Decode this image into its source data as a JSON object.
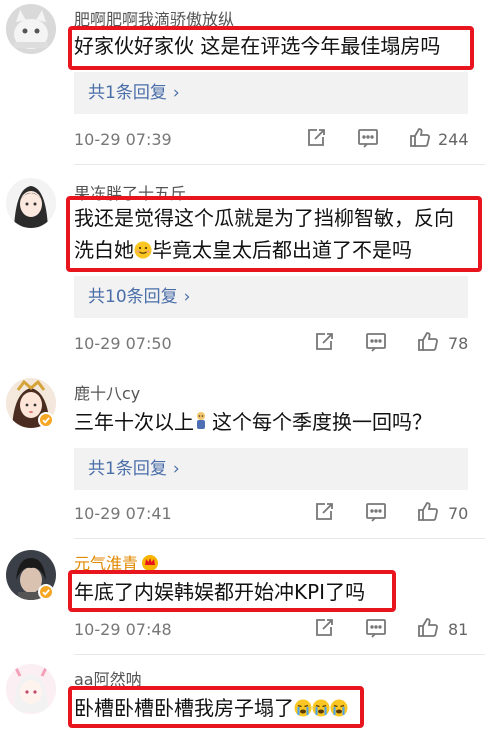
{
  "comments": [
    {
      "username": "肥啊肥啊我滴骄傲放纵",
      "text": "好家伙好家伙 这是在评选今年最佳塌房吗",
      "replies": "共1条回复",
      "date": "10-29 07:39",
      "likes": "244"
    },
    {
      "username": "果冻胖了十五斤",
      "text_line1": "我还是觉得这个瓜就是为了挡柳智敏，反向",
      "text_line2a": "洗白她",
      "text_line2b": "毕竟太皇太后都出道了不是吗",
      "replies": "共10条回复",
      "date": "10-29 07:50",
      "likes": "78"
    },
    {
      "username": "鹿十八cy",
      "text_a": "三年十次以上",
      "text_b": "这个每个季度换一回吗？",
      "replies": "共1条回复",
      "date": "10-29 07:41",
      "likes": "70"
    },
    {
      "username": "元气淮青",
      "text": "年底了内娱韩娱都开始冲KPI了吗",
      "date": "10-29 07:48",
      "likes": "81"
    },
    {
      "username": "aa阿然呐",
      "text": "卧槽卧槽卧槽我房子塌了"
    }
  ],
  "icons": {
    "share": "share-icon",
    "comment": "comment-icon",
    "like": "thumbs-up-icon",
    "chevron": "chevron-right-icon"
  },
  "colors": {
    "highlight_box": "#e8141e",
    "link_blue": "#4a6ea8",
    "vip_gold": "#e08a00"
  }
}
